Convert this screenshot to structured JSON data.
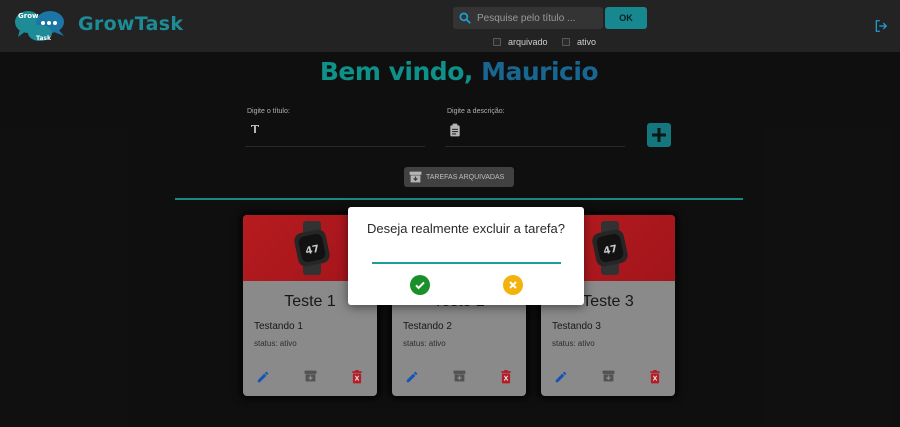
{
  "header": {
    "logo_text_top": "Grow",
    "logo_text_bottom": "Task",
    "brand": "GrowTask",
    "search": {
      "placeholder": "Pesquise pelo título ...",
      "value": ""
    },
    "ok_label": "OK",
    "filters": [
      {
        "label": "arquivado",
        "checked": false
      },
      {
        "label": "ativo",
        "checked": false
      }
    ]
  },
  "welcome": {
    "greeting": "Bem vindo,",
    "user": "Mauricio"
  },
  "form": {
    "title_label": "Digite o título:",
    "description_label": "Digite a descrição:",
    "archived_button": "TAREFAS ARQUIVADAS"
  },
  "cards": [
    {
      "title": "Teste 1",
      "description": "Testando 1",
      "status": "status: ativo"
    },
    {
      "title": "Teste 2",
      "description": "Testando 2",
      "status": "status: ativo"
    },
    {
      "title": "Teste 3",
      "description": "Testando 3",
      "status": "status: ativo"
    }
  ],
  "dialog": {
    "message": "Deseja realmente excluir a tarefa?"
  },
  "colors": {
    "accent": "#17888f",
    "brand_dark": "#1b76a6",
    "delete": "#d0202b",
    "edit": "#1b5fd1",
    "confirm": "#1a8f2a",
    "cancel": "#f4b20d"
  }
}
